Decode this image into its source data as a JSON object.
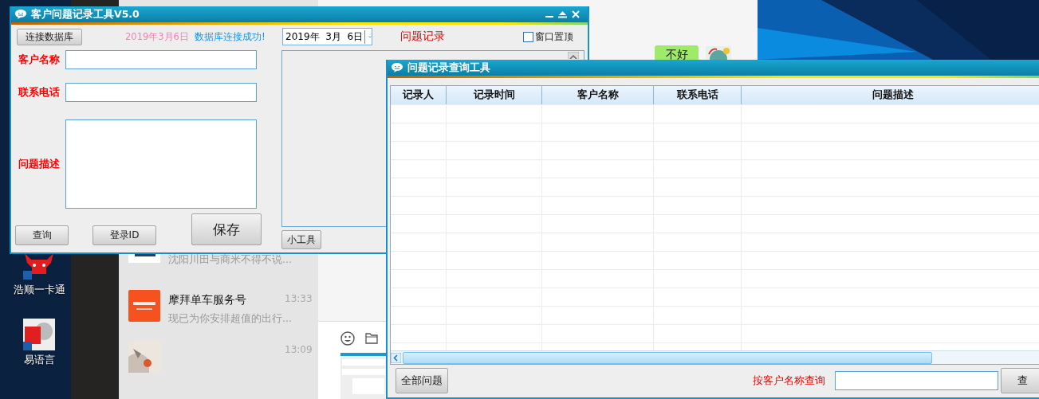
{
  "desktop_icons": [
    {
      "label": "浩顺一卡通",
      "kind": "bull"
    },
    {
      "label": "易语言",
      "kind": "yi"
    }
  ],
  "chat_list": [
    {
      "subtitle": "沈阳川田与商米不得不说...",
      "kind": "device"
    },
    {
      "title": "摩拜单车服务号",
      "time": "13:33",
      "subtitle": "现已为你安排超值的出行...",
      "kind": "brand"
    },
    {
      "time": "13:09"
    }
  ],
  "chat_bubble": {
    "text": "不好"
  },
  "record_window": {
    "title": "客户问题记录工具V5.0",
    "connect_button": "连接数据库",
    "date_text": "2019年3月6日",
    "status": "数据库连接成功!",
    "date_picker": {
      "value": "2019年  3月  6日"
    },
    "heading": "问题记录",
    "topmost": {
      "label": "窗口置顶",
      "checked": false
    },
    "fields": [
      {
        "label": "客户名称",
        "kind": "line"
      },
      {
        "label": "联系电话",
        "kind": "line"
      },
      {
        "label": "问题描述",
        "kind": "area"
      }
    ],
    "buttons": [
      "查询",
      "登录ID",
      "保存"
    ],
    "tools_button": "小工具"
  },
  "query_window": {
    "title": "问题记录查询工具",
    "table": {
      "columns": [
        "记录人",
        "记录时间",
        "客户名称",
        "联系电话",
        "问题描述"
      ]
    },
    "all_button": "全部问题",
    "search_label": "按客户名称查询",
    "search_button": "查"
  }
}
